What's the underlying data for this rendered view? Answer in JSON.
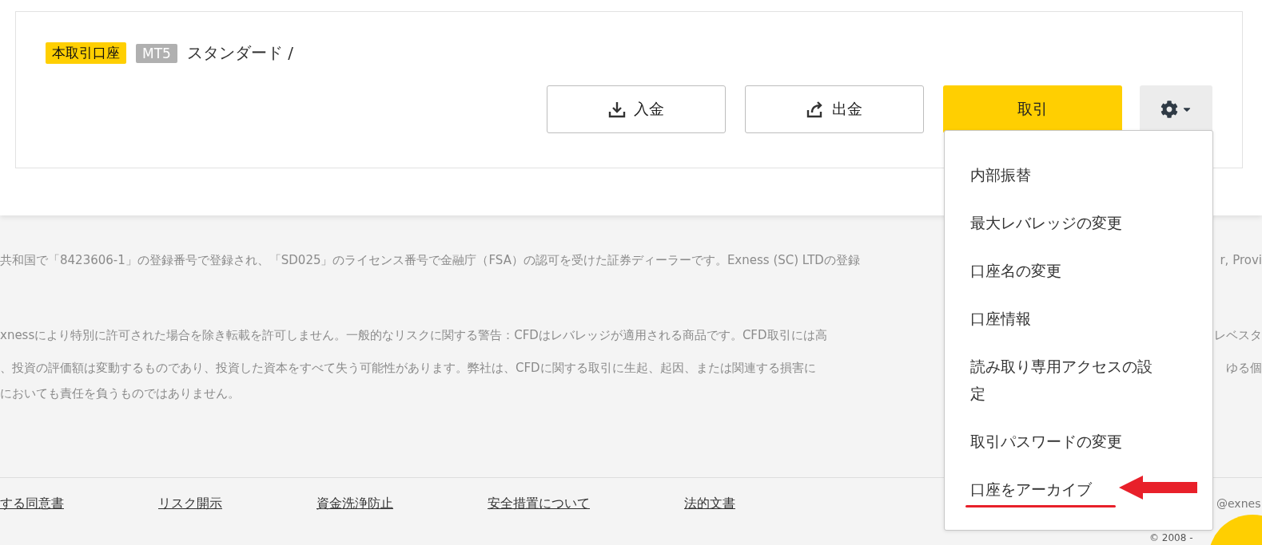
{
  "account": {
    "badges": [
      {
        "kind": "account_type",
        "label": "本取引口座"
      },
      {
        "kind": "platform",
        "label": "MT5"
      }
    ],
    "name": "スタンダード /"
  },
  "actions": [
    {
      "kind": "deposit",
      "label": "入金"
    },
    {
      "kind": "withdraw",
      "label": "出金"
    },
    {
      "kind": "trade",
      "label": "取引"
    },
    {
      "kind": "settings"
    }
  ],
  "menu": {
    "items": [
      {
        "label": "内部振替",
        "annotated": false
      },
      {
        "label": "最大レバレッジの変更",
        "annotated": false
      },
      {
        "label": "口座名の変更",
        "annotated": false
      },
      {
        "label": "口座情報",
        "annotated": false
      },
      {
        "label": "読み取り専用アクセスの設定",
        "annotated": false
      },
      {
        "label": "取引パスワードの変更",
        "annotated": false
      },
      {
        "label": "口座をアーカイブ",
        "annotated": true
      }
    ]
  },
  "disclaimer": [
    {
      "left": "共和国で「8423606-1」の登録番号で登録され、「SD025」のライセンス番号で金融庁（FSA）の認可を受けた証券ディーラーです。Exness (SC) LTDの登録",
      "right": "r, Provi"
    },
    {
      "left": "xnessにより特別に許可された場合を除き転載を許可しません。一般的なリスクに関する警告：CFDはレバレッジが適用される商品です。CFD取引には高",
      "right": "レベスタ"
    },
    {
      "left": "、投資の評価額は変動するものであり、投資した資本をすべて失う可能性があります。弊社は、CFDに関する取引に生起、起因、または関連する損害に",
      "right": "ゆる個"
    },
    {
      "left": "においても責任を負うものではありません。"
    }
  ],
  "footer_links": [
    "する同意書",
    "リスク開示",
    "資金洗浄防止",
    "安全措置について",
    "法的文書"
  ],
  "footer_contact": "@exnes",
  "copyright": "© 2008 -"
}
